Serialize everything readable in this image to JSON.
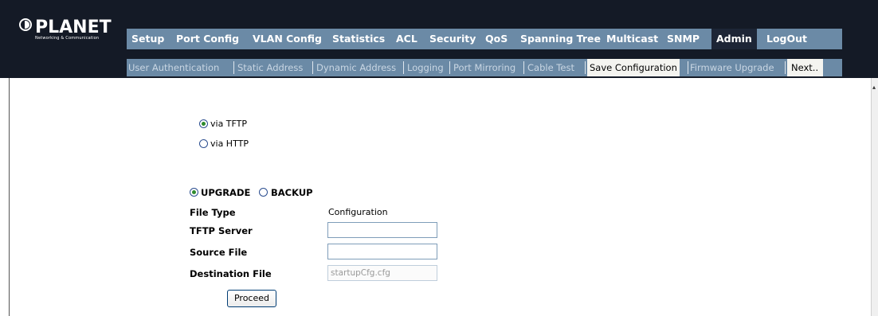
{
  "brand": {
    "name": "PLANET",
    "tagline": "Networking & Communication"
  },
  "main_nav": [
    {
      "label": "Setup",
      "active": false
    },
    {
      "label": "Port Config",
      "active": false
    },
    {
      "label": "VLAN Config",
      "active": false
    },
    {
      "label": "Statistics",
      "active": false
    },
    {
      "label": "ACL",
      "active": false
    },
    {
      "label": "Security",
      "active": false
    },
    {
      "label": "QoS",
      "active": false
    },
    {
      "label": "Spanning Tree",
      "active": false
    },
    {
      "label": "Multicast",
      "active": false
    },
    {
      "label": "SNMP",
      "active": false
    },
    {
      "label": "Admin",
      "active": true
    },
    {
      "label": "LogOut",
      "active": false
    }
  ],
  "sub_nav": [
    {
      "label": "User Authentication",
      "active": false
    },
    {
      "label": "Static Address",
      "active": false
    },
    {
      "label": "Dynamic Address",
      "active": false
    },
    {
      "label": "Logging",
      "active": false
    },
    {
      "label": "Port Mirroring",
      "active": false
    },
    {
      "label": "Cable Test",
      "active": false
    },
    {
      "label": "Save Configuration",
      "active": true
    },
    {
      "label": "Firmware Upgrade",
      "active": false
    },
    {
      "label": "Next..",
      "active": true
    }
  ],
  "method": {
    "tftp_label": "via TFTP",
    "http_label": "via HTTP",
    "selected": "via TFTP"
  },
  "mode": {
    "upgrade_label": "UPGRADE",
    "backup_label": "BACKUP",
    "selected": "UPGRADE"
  },
  "form": {
    "file_type_label": "File Type",
    "file_type_value": "Configuration",
    "tftp_server_label": "TFTP Server",
    "tftp_server_value": "",
    "source_file_label": "Source File",
    "source_file_value": "",
    "dest_file_label": "Destination File",
    "dest_file_value": "startupCfg.cfg",
    "proceed_label": "Proceed"
  },
  "colors": {
    "header_bg": "#141a26",
    "nav_bg": "#6b8aa6",
    "active_main_tab": "#1d2536",
    "active_sub_tab": "#f4f4f0"
  }
}
